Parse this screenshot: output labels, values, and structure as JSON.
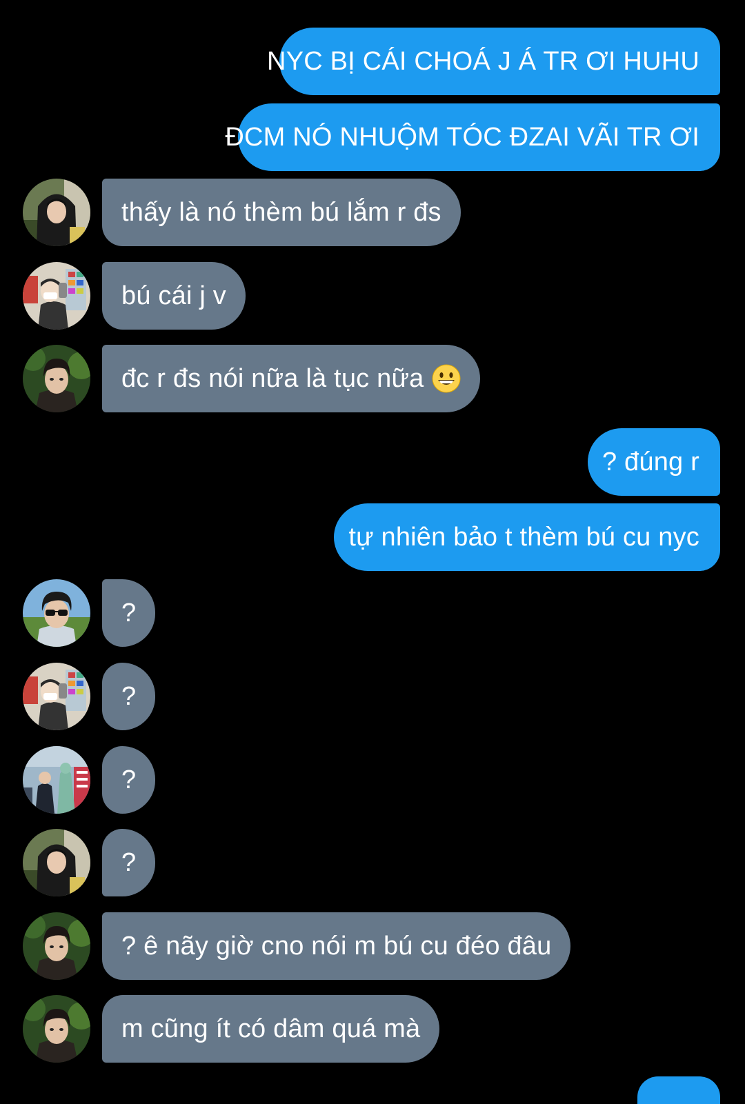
{
  "messages": [
    {
      "dir": "out",
      "text": "NYC BỊ CÁI CHOÁ J Á TR ƠI HUHU",
      "shape": "first"
    },
    {
      "dir": "out",
      "text": "ĐCM NÓ NHUỘM TÓC ĐZAI VÃI TR ƠI",
      "shape": "last"
    },
    {
      "dir": "in",
      "text": "thấy là nó thèm bú lắm r đs",
      "avatar": "avatar-hoodie"
    },
    {
      "dir": "in",
      "text": "bú cái j v",
      "avatar": "avatar-mirror-selfie"
    },
    {
      "dir": "in",
      "text": "đc r đs nói nữa là tục nữa",
      "avatar": "avatar-portrait",
      "emoji": "grinning-face-emoji"
    },
    {
      "dir": "out",
      "text": "? đúng r",
      "shape": "first"
    },
    {
      "dir": "out",
      "text": "tự nhiên bảo t thèm bú cu nyc",
      "shape": "last"
    },
    {
      "dir": "in",
      "text": "?",
      "avatar": "avatar-sunglasses"
    },
    {
      "dir": "in",
      "text": "?",
      "avatar": "avatar-mirror-selfie"
    },
    {
      "dir": "in",
      "text": "?",
      "avatar": "avatar-statue-photo"
    },
    {
      "dir": "in",
      "text": "?",
      "avatar": "avatar-hoodie"
    },
    {
      "dir": "in",
      "text": "? ê nãy giờ cno nói m bú cu đéo đâu",
      "avatar": "avatar-portrait"
    },
    {
      "dir": "in",
      "text": "m cũng ít có dâm quá mà",
      "avatar": "avatar-portrait"
    }
  ],
  "colors": {
    "background": "#000000",
    "sent_bubble": "#1d9bf0",
    "received_bubble": "#66788a",
    "text": "#ffffff"
  }
}
